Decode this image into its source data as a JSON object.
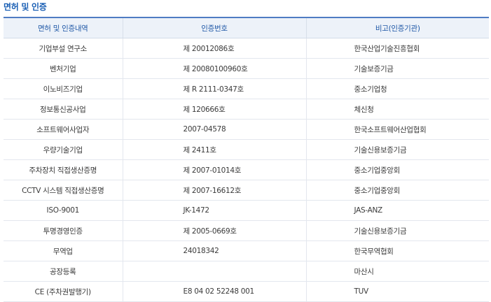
{
  "title": "면허 및 인증",
  "headers": [
    "면허 및 인증내역",
    "인증번호",
    "비고(인증기관)"
  ],
  "rows": [
    {
      "item": "기업부설 연구소",
      "number": "제 20012086호",
      "agency": "한국산업기술진흥협회"
    },
    {
      "item": "벤처기업",
      "number": "제 20080100960호",
      "agency": "기술보증기금"
    },
    {
      "item": "이노비즈기업",
      "number": "제 R 2111-0347호",
      "agency": "중소기업청"
    },
    {
      "item": "정보통신공사업",
      "number": "제 120666호",
      "agency": "체신청"
    },
    {
      "item": "소프트웨어사업자",
      "number": "2007-04578",
      "agency": "한국소프트웨어산업협회"
    },
    {
      "item": "우량기술기업",
      "number": "제 2411호",
      "agency": "기술신용보증기금"
    },
    {
      "item": "주차장치 직접생산증명",
      "number": "제 2007-01014호",
      "agency": "중소기업중앙회"
    },
    {
      "item": "CCTV 시스템 직접생산증명",
      "number": "제 2007-16612호",
      "agency": "중소기업중앙회"
    },
    {
      "item": "ISO-9001",
      "number": "JK-1472",
      "agency": "JAS-ANZ"
    },
    {
      "item": "투명경영인증",
      "number": "제 2005-0669호",
      "agency": "기술신용보증기금"
    },
    {
      "item": "무역업",
      "number": "24018342",
      "agency": "한국무역협회"
    },
    {
      "item": "공장등록",
      "number": "",
      "agency": "마산시"
    },
    {
      "item": "CE (주차권발행기)",
      "number": "E8 04 02 52248 001",
      "agency": "TUV"
    }
  ]
}
